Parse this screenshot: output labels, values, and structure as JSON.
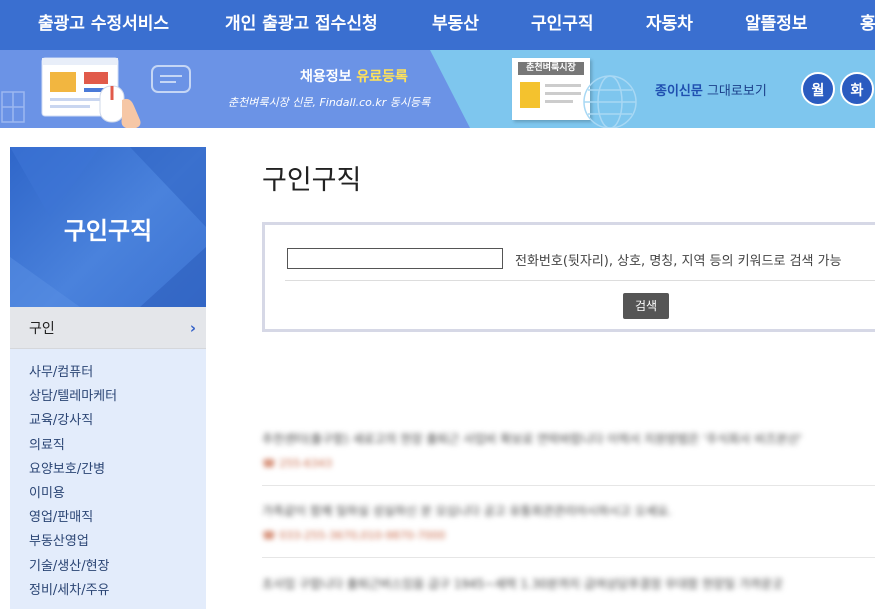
{
  "topnav": {
    "items": [
      "출광고 수정서비스",
      "개인 출광고 접수신청",
      "부동산",
      "구인구직",
      "자동차",
      "알뜰정보",
      "홍"
    ]
  },
  "banner": {
    "promo_title_lead": "채용정보",
    "promo_title_accent": "유료등록",
    "promo_sub": "춘천벼룩시장 신문, Findall.co.kr 동시등록",
    "paper_label": "춘천벼룩시장",
    "paper_link_lead": "종이신문",
    "paper_link_rest": " 그대로보기",
    "day_buttons": [
      "월",
      "화"
    ],
    "colors": {
      "left": "#6b93e6",
      "right": "#7ec6ee",
      "accent": "#ffe25a"
    }
  },
  "sidebar": {
    "title": "구인구직",
    "active_item": "구인",
    "active_chevron": "›",
    "items": [
      "사무/컴퓨터",
      "상담/텔레마케터",
      "교육/강사직",
      "의료직",
      "요양보호/간병",
      "이미용",
      "영업/판매직",
      "부동산영업",
      "기술/생산/현장",
      "정비/세차/주유"
    ]
  },
  "main": {
    "title": "구인구직",
    "search": {
      "input_value": "",
      "hint": "전화번호(뒷자리), 상호, 명칭, 지역 등의 키워드로 검색 가능",
      "button_label": "검색"
    },
    "listings": [
      {
        "text": "추천센터(출구함) 새로고의 현장 출퇴근 사업비 확보로 연락바랍니다 이력서 지원방법은 '주식회사 비즈본산'",
        "phone": "☎ 255-6343"
      },
      {
        "text": "가족같이 함께 일하실 성실하신 분 모십니다 공고 유통회관관리아시하시고 오세요.",
        "phone": "☎ 033-255-3670,010-9870-7000"
      },
      {
        "text": "초사업 구합니다 출퇴근버스있음 급구 1945~세력 1.30분까지 급여상담후결정 우대함 현장일 가까운곳",
        "phone": ""
      }
    ]
  }
}
